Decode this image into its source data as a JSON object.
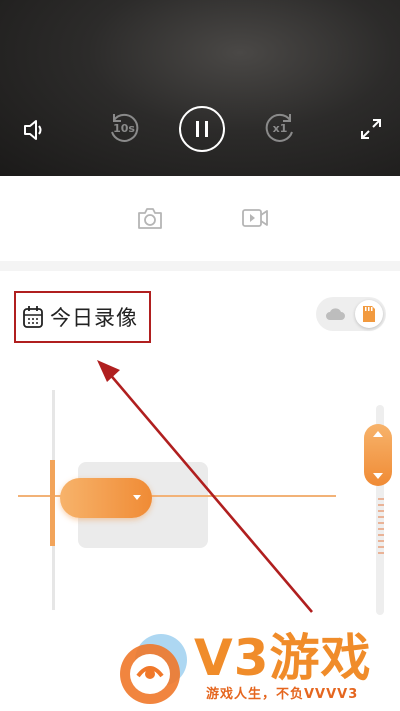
{
  "player": {
    "controls": [
      {
        "name": "volume-icon"
      },
      {
        "name": "rewind-10s-icon",
        "label": "10s"
      },
      {
        "name": "pause-icon"
      },
      {
        "name": "speed-icon",
        "label": "x1"
      },
      {
        "name": "fullscreen-icon"
      }
    ]
  },
  "toolbar": {
    "items": [
      {
        "name": "screenshot-icon"
      },
      {
        "name": "record-video-icon"
      }
    ]
  },
  "recording": {
    "title": "今日录像",
    "icon": "calendar-icon",
    "storage_toggle": {
      "options": [
        "cloud-icon",
        "sd-card-icon"
      ],
      "selected": "sd-card-icon"
    }
  },
  "annotation": {
    "color": "#b01f1f"
  },
  "watermark": {
    "brand": "V3游戏",
    "slogan": "游戏人生，不负VVVV3"
  },
  "colors": {
    "accent": "#f08b35",
    "highlight": "#b01f1f"
  }
}
